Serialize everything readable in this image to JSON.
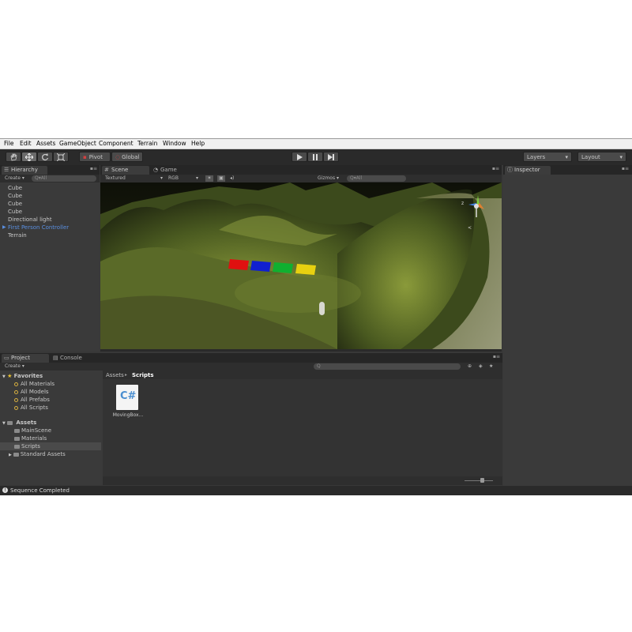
{
  "menu": [
    "File",
    "Edit",
    "Assets",
    "GameObject",
    "Component",
    "Terrain",
    "Window",
    "Help"
  ],
  "toolbar": {
    "transform_tools": [
      "hand-icon",
      "move-icon",
      "rotate-icon",
      "scale-icon"
    ],
    "pivot": "Pivot",
    "global": "Global",
    "playback": [
      "play-icon",
      "pause-icon",
      "step-icon"
    ],
    "layers": "Layers",
    "layout": "Layout"
  },
  "hierarchy": {
    "tab": "Hierarchy",
    "create": "Create",
    "search_placeholder": "All",
    "items": [
      "Cube",
      "Cube",
      "Cube",
      "Cube",
      "Directional light",
      "First Person Controller",
      "Terrain"
    ],
    "highlighted_index": 5
  },
  "scene": {
    "tabs": [
      "Scene",
      "Game"
    ],
    "shading": "Textured",
    "render_mode": "RGB",
    "gizmos": "Gizmos",
    "search_placeholder": "All",
    "axis_label": "z",
    "persp_label": "<"
  },
  "inspector": {
    "tab": "Inspector"
  },
  "project": {
    "tabs": [
      "Project",
      "Console"
    ],
    "create": "Create",
    "favorites_label": "Favorites",
    "favorites": [
      "All Materials",
      "All Models",
      "All Prefabs",
      "All Scripts"
    ],
    "assets_label": "Assets",
    "assets": [
      "MainScene",
      "Materials",
      "Scripts",
      "Standard Assets"
    ],
    "selected_asset": "Scripts",
    "breadcrumb": [
      "Assets",
      "Scripts"
    ],
    "file_icon_text": "C#",
    "file_name": "MovingBox..."
  },
  "status": {
    "text": "Sequence Completed"
  },
  "colors": {
    "red": "#e01010",
    "blue": "#1020d0",
    "green": "#10b030",
    "yellow": "#e8d010",
    "selection": "#5a8fe0"
  }
}
